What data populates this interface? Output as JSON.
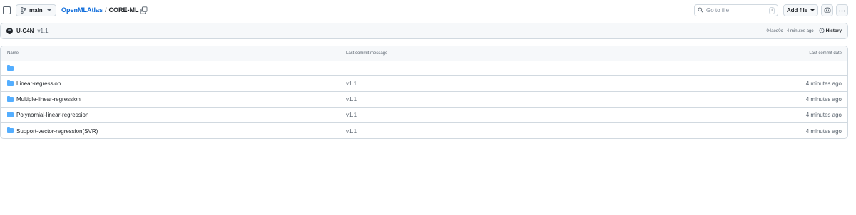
{
  "header": {
    "branch": "main",
    "breadcrumb": {
      "repo": "OpenMLAtlas",
      "sep1": "/",
      "folder": "CORE-ML",
      "sep2": "/"
    },
    "search": {
      "placeholder": "Go to file",
      "shortcut": "t"
    },
    "add_file_label": "Add file"
  },
  "commit": {
    "author": "U-C4N",
    "message": "v1.1",
    "meta": "04aed0c · 4 minutes ago",
    "history_label": "History"
  },
  "table": {
    "columns": {
      "name": "Name",
      "message": "Last commit message",
      "date": "Last commit date"
    },
    "parent_label": "..",
    "rows": [
      {
        "name": "Linear-regression",
        "message": "v1.1",
        "date": "4 minutes ago"
      },
      {
        "name": "Multiple-linear-regression",
        "message": "v1.1",
        "date": "4 minutes ago"
      },
      {
        "name": "Polynomial-linear-regression",
        "message": "v1.1",
        "date": "4 minutes ago"
      },
      {
        "name": "Support-vector-regression(SVR)",
        "message": "v1.1",
        "date": "4 minutes ago"
      }
    ]
  },
  "colors": {
    "link": "#0969da",
    "folder": "#54aeff",
    "border": "#d1d9e0",
    "muted": "#59636e"
  }
}
